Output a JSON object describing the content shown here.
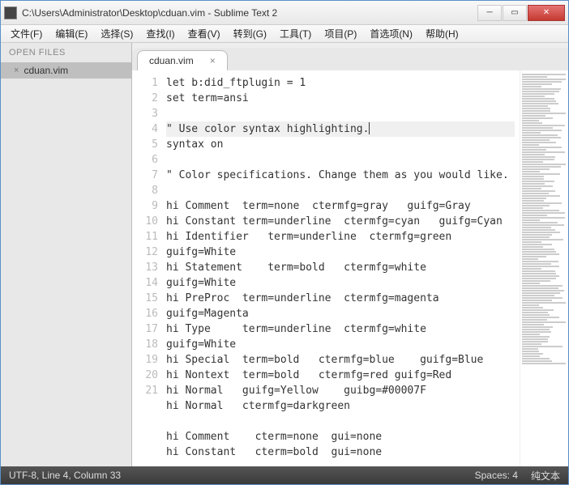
{
  "window": {
    "title": "C:\\Users\\Administrator\\Desktop\\cduan.vim - Sublime Text 2"
  },
  "menu": {
    "file": "文件(F)",
    "edit": "编辑(E)",
    "select": "选择(S)",
    "find": "查找(I)",
    "view": "查看(V)",
    "goto": "转到(G)",
    "tools": "工具(T)",
    "project": "项目(P)",
    "prefs": "首选项(N)",
    "help": "帮助(H)"
  },
  "sidebar": {
    "header": "OPEN FILES",
    "items": [
      {
        "close": "×",
        "label": "cduan.vim"
      }
    ]
  },
  "tabs": [
    {
      "label": "cduan.vim",
      "close": "×"
    }
  ],
  "code": {
    "lines": [
      "let b:did_ftplugin = 1",
      "set term=ansi",
      "",
      "\" Use color syntax highlighting.",
      "syntax on",
      "",
      "\" Color specifications. Change them as you would like.",
      "",
      "hi Comment  term=none  ctermfg=gray   guifg=Gray",
      "hi Constant term=underline  ctermfg=cyan   guifg=Cyan",
      "hi Identifier   term=underline  ctermfg=green   guifg=White",
      "hi Statement    term=bold   ctermfg=white   guifg=White",
      "hi PreProc  term=underline  ctermfg=magenta guifg=Magenta",
      "hi Type     term=underline  ctermfg=white   guifg=White",
      "hi Special  term=bold   ctermfg=blue    guifg=Blue",
      "hi Nontext  term=bold   ctermfg=red guifg=Red",
      "hi Normal   guifg=Yellow    guibg=#00007F",
      "hi Normal   ctermfg=darkgreen",
      "",
      "hi Comment    cterm=none  gui=none",
      "hi Constant   cterm=bold  gui=none"
    ],
    "highlight_line": 4
  },
  "status": {
    "left": "UTF-8, Line 4, Column 33",
    "spaces": "Spaces: 4",
    "syntax": "纯文本"
  }
}
